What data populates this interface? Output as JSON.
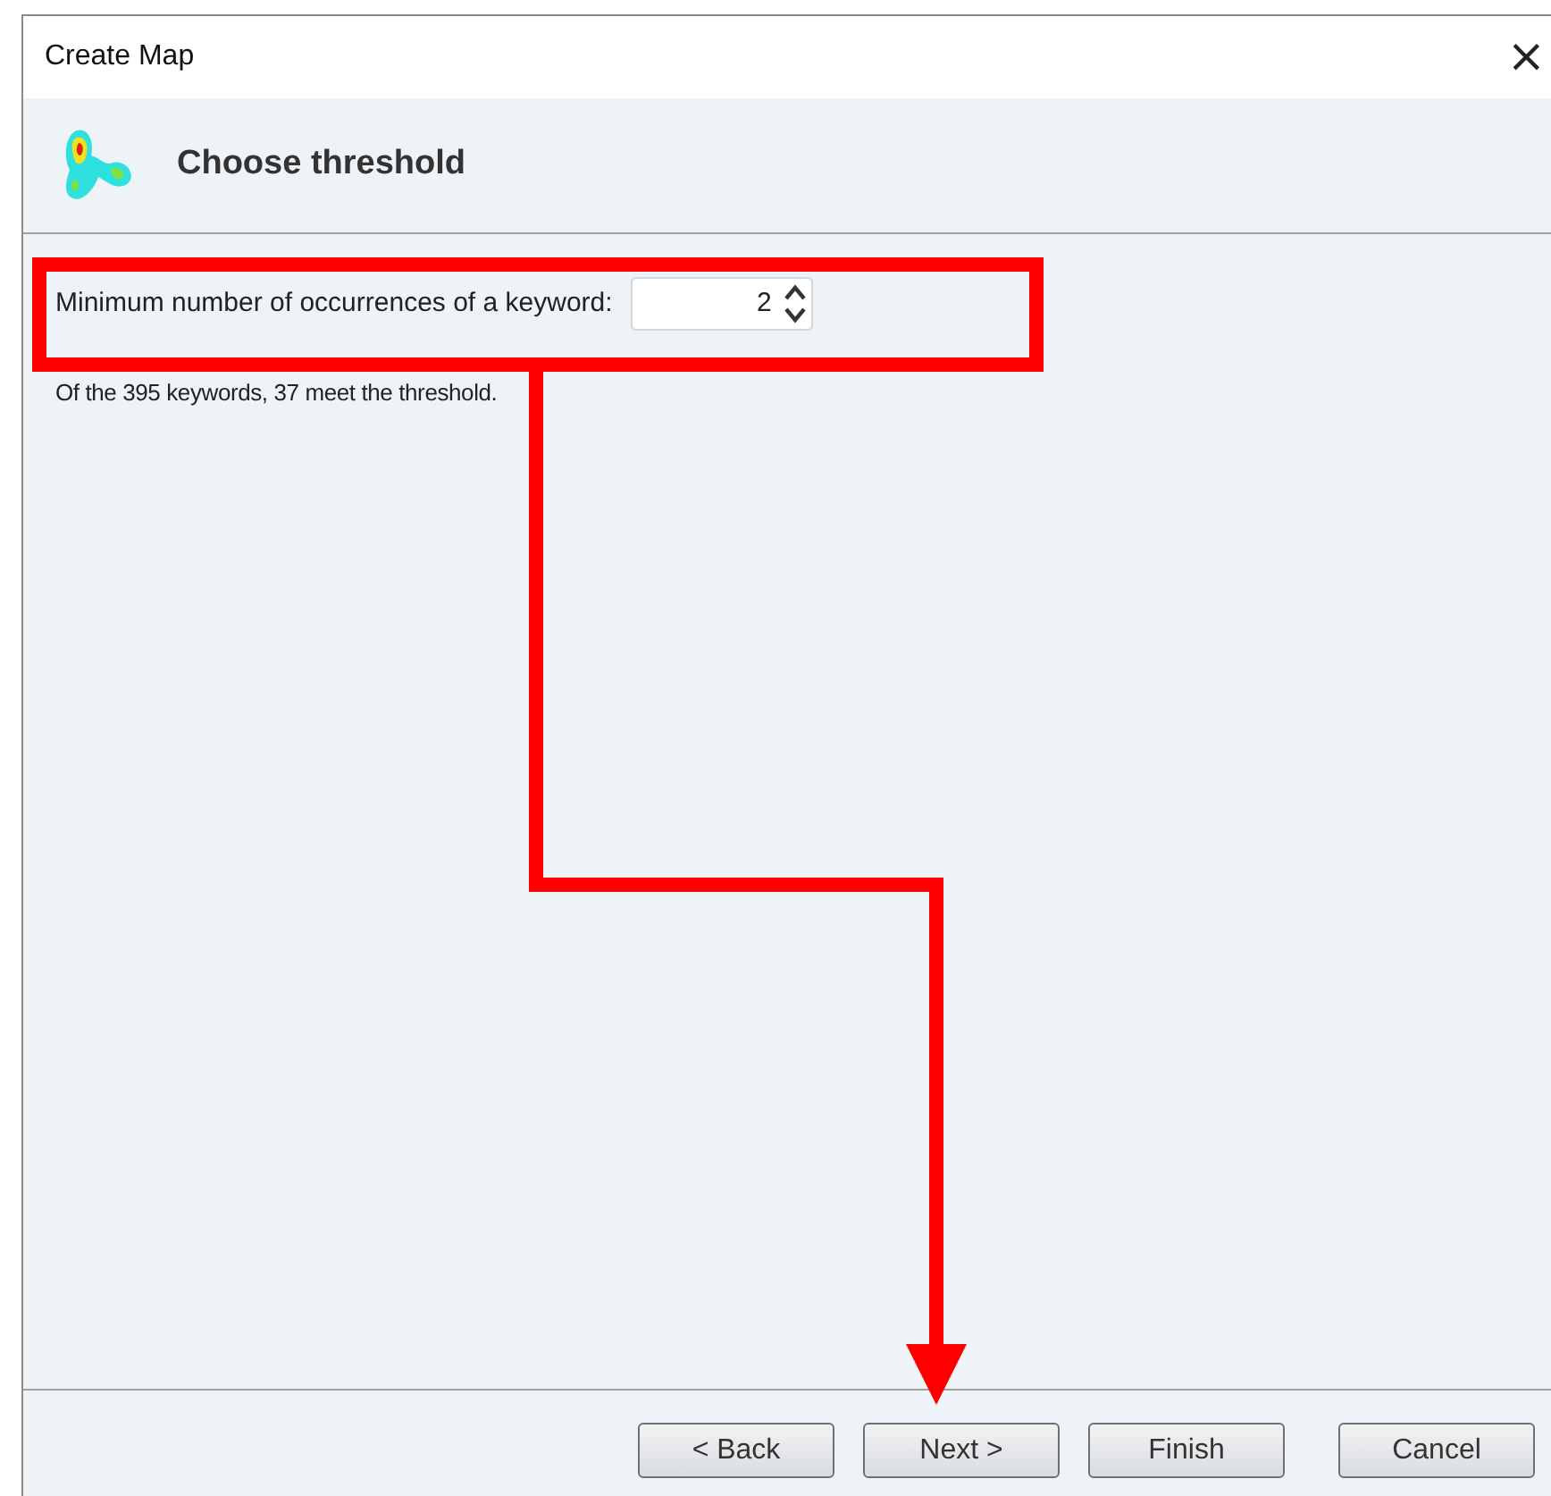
{
  "window": {
    "title": "Create Map",
    "close": "×"
  },
  "header": {
    "title": "Choose threshold"
  },
  "threshold": {
    "label": "Minimum number of occurrences of a keyword:",
    "value": "2"
  },
  "info": "Of the 395 keywords, 37 meet the threshold.",
  "buttons": [
    {
      "label": "< Back"
    },
    {
      "label": "Next >"
    },
    {
      "label": "Finish"
    },
    {
      "label": "Cancel"
    }
  ]
}
